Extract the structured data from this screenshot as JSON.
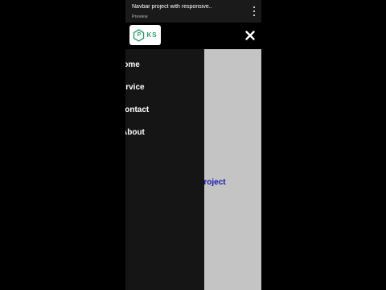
{
  "video": {
    "title": "Navbar project with responsive..",
    "subtitle": "Preview",
    "more_icon": "more-vert-icon"
  },
  "navbar": {
    "logo_hex_letter": "P",
    "logo_letters": "KS",
    "logo_color": "#2a9d6a",
    "close_icon": "close-icon"
  },
  "drawer": {
    "items": [
      {
        "label": "Home"
      },
      {
        "label": "Service"
      },
      {
        "label": "Contact"
      },
      {
        "label": "About"
      }
    ]
  },
  "main": {
    "hero_text": "Navbar Project",
    "hero_color": "#1515b0"
  }
}
